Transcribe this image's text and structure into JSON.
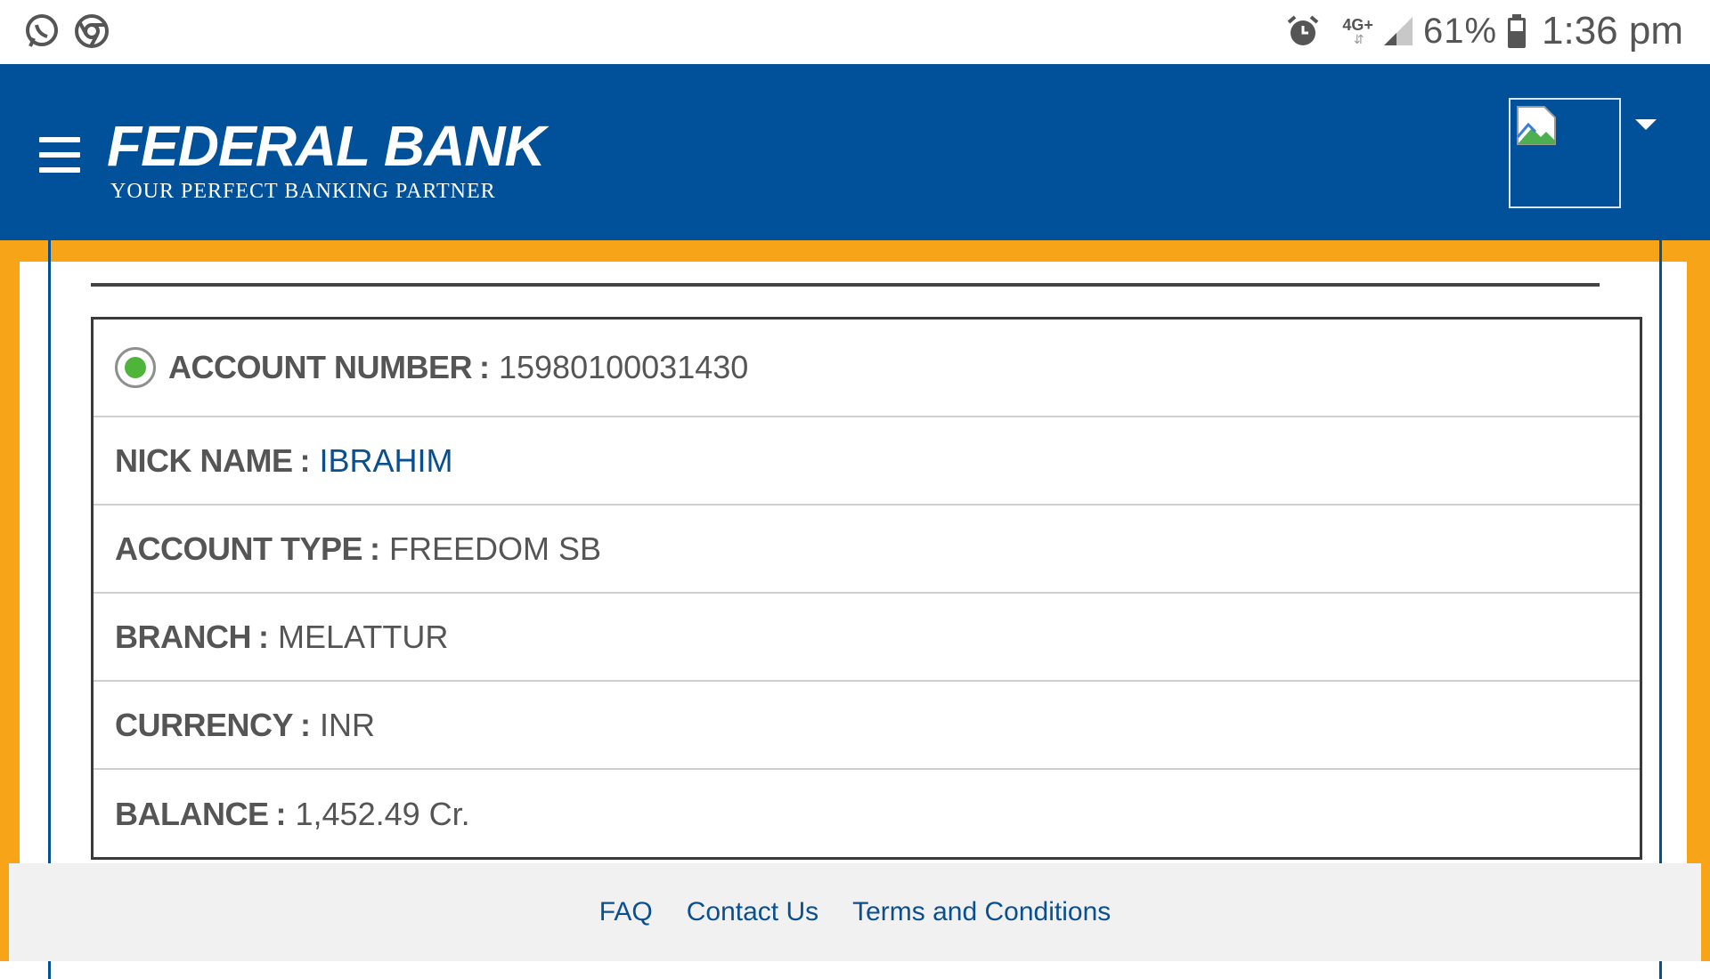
{
  "status_bar": {
    "battery_pct": "61%",
    "time": "1:36 pm",
    "network": "4G+",
    "icons": [
      "whatsapp-icon",
      "chrome-icon",
      "alarm-icon",
      "signal-icon",
      "battery-icon"
    ]
  },
  "header": {
    "brand": "FEDERAL BANK",
    "tagline": "YOUR PERFECT BANKING PARTNER",
    "bg_color": "#00509a"
  },
  "account": {
    "rows": [
      {
        "label": "ACCOUNT NUMBER",
        "value": "15980100031430"
      },
      {
        "label": "NICK NAME",
        "value": "IBRAHIM"
      },
      {
        "label": "ACCOUNT TYPE",
        "value": "FREEDOM SB"
      },
      {
        "label": "BRANCH",
        "value": "MELATTUR"
      },
      {
        "label": "CURRENCY",
        "value": "INR"
      },
      {
        "label": "BALANCE",
        "value": "1,452.49 Cr."
      }
    ]
  },
  "footer": {
    "links": [
      "FAQ",
      "Contact Us",
      "Terms and Conditions"
    ]
  },
  "colors": {
    "accent_orange": "#f7a418",
    "brand_blue": "#00509a",
    "link_blue": "#0a4f8f",
    "radio_green": "#4fb53a"
  }
}
